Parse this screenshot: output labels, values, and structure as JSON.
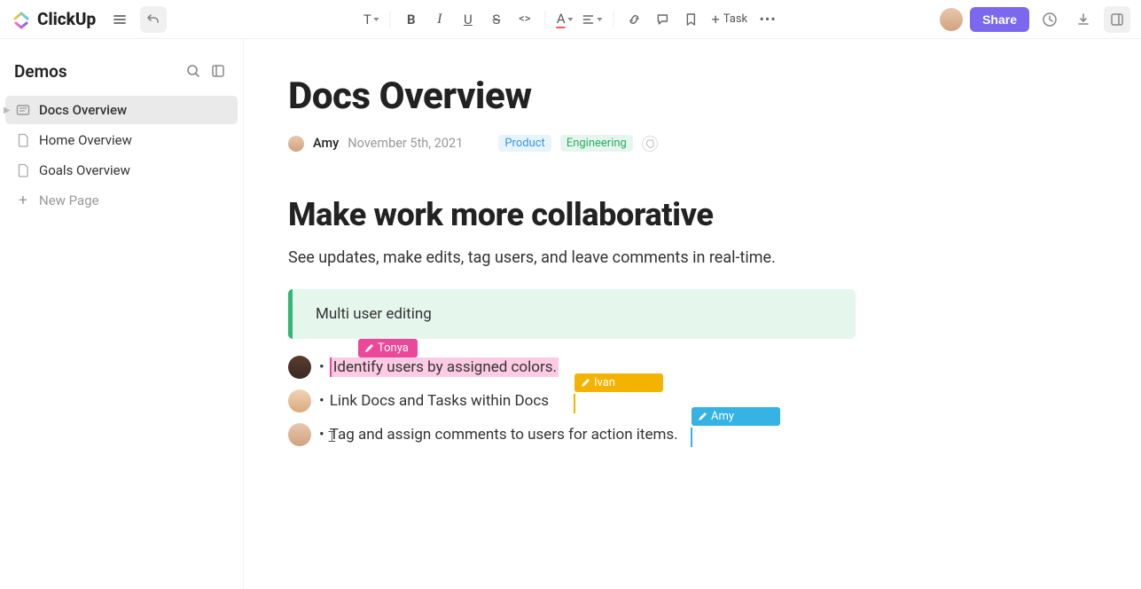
{
  "topbar": {
    "logo_text": "ClickUp",
    "add_task_label": "Task",
    "share_label": "Share"
  },
  "sidebar": {
    "title": "Demos",
    "items": [
      {
        "label": "Docs Overview",
        "active": true
      },
      {
        "label": "Home Overview",
        "active": false
      },
      {
        "label": "Goals Overview",
        "active": false
      }
    ],
    "new_page_label": "New Page"
  },
  "doc": {
    "title": "Docs Overview",
    "author": "Amy",
    "date": "November 5th, 2021",
    "tags": {
      "product": "Product",
      "engineering": "Engineering"
    },
    "heading": "Make work more collaborative",
    "paragraph": "See updates, make edits, tag users, and leave comments in real-time.",
    "callout": "Multi user editing",
    "bullets": [
      {
        "text": "Identify users by assigned colors.",
        "cursor_user": "Tonya",
        "highlight": true
      },
      {
        "text": "Link Docs and Tasks within Docs",
        "cursor_user": "Ivan"
      },
      {
        "text": "Tag and assign comments to users for action items.",
        "cursor_user": "Amy"
      }
    ]
  }
}
